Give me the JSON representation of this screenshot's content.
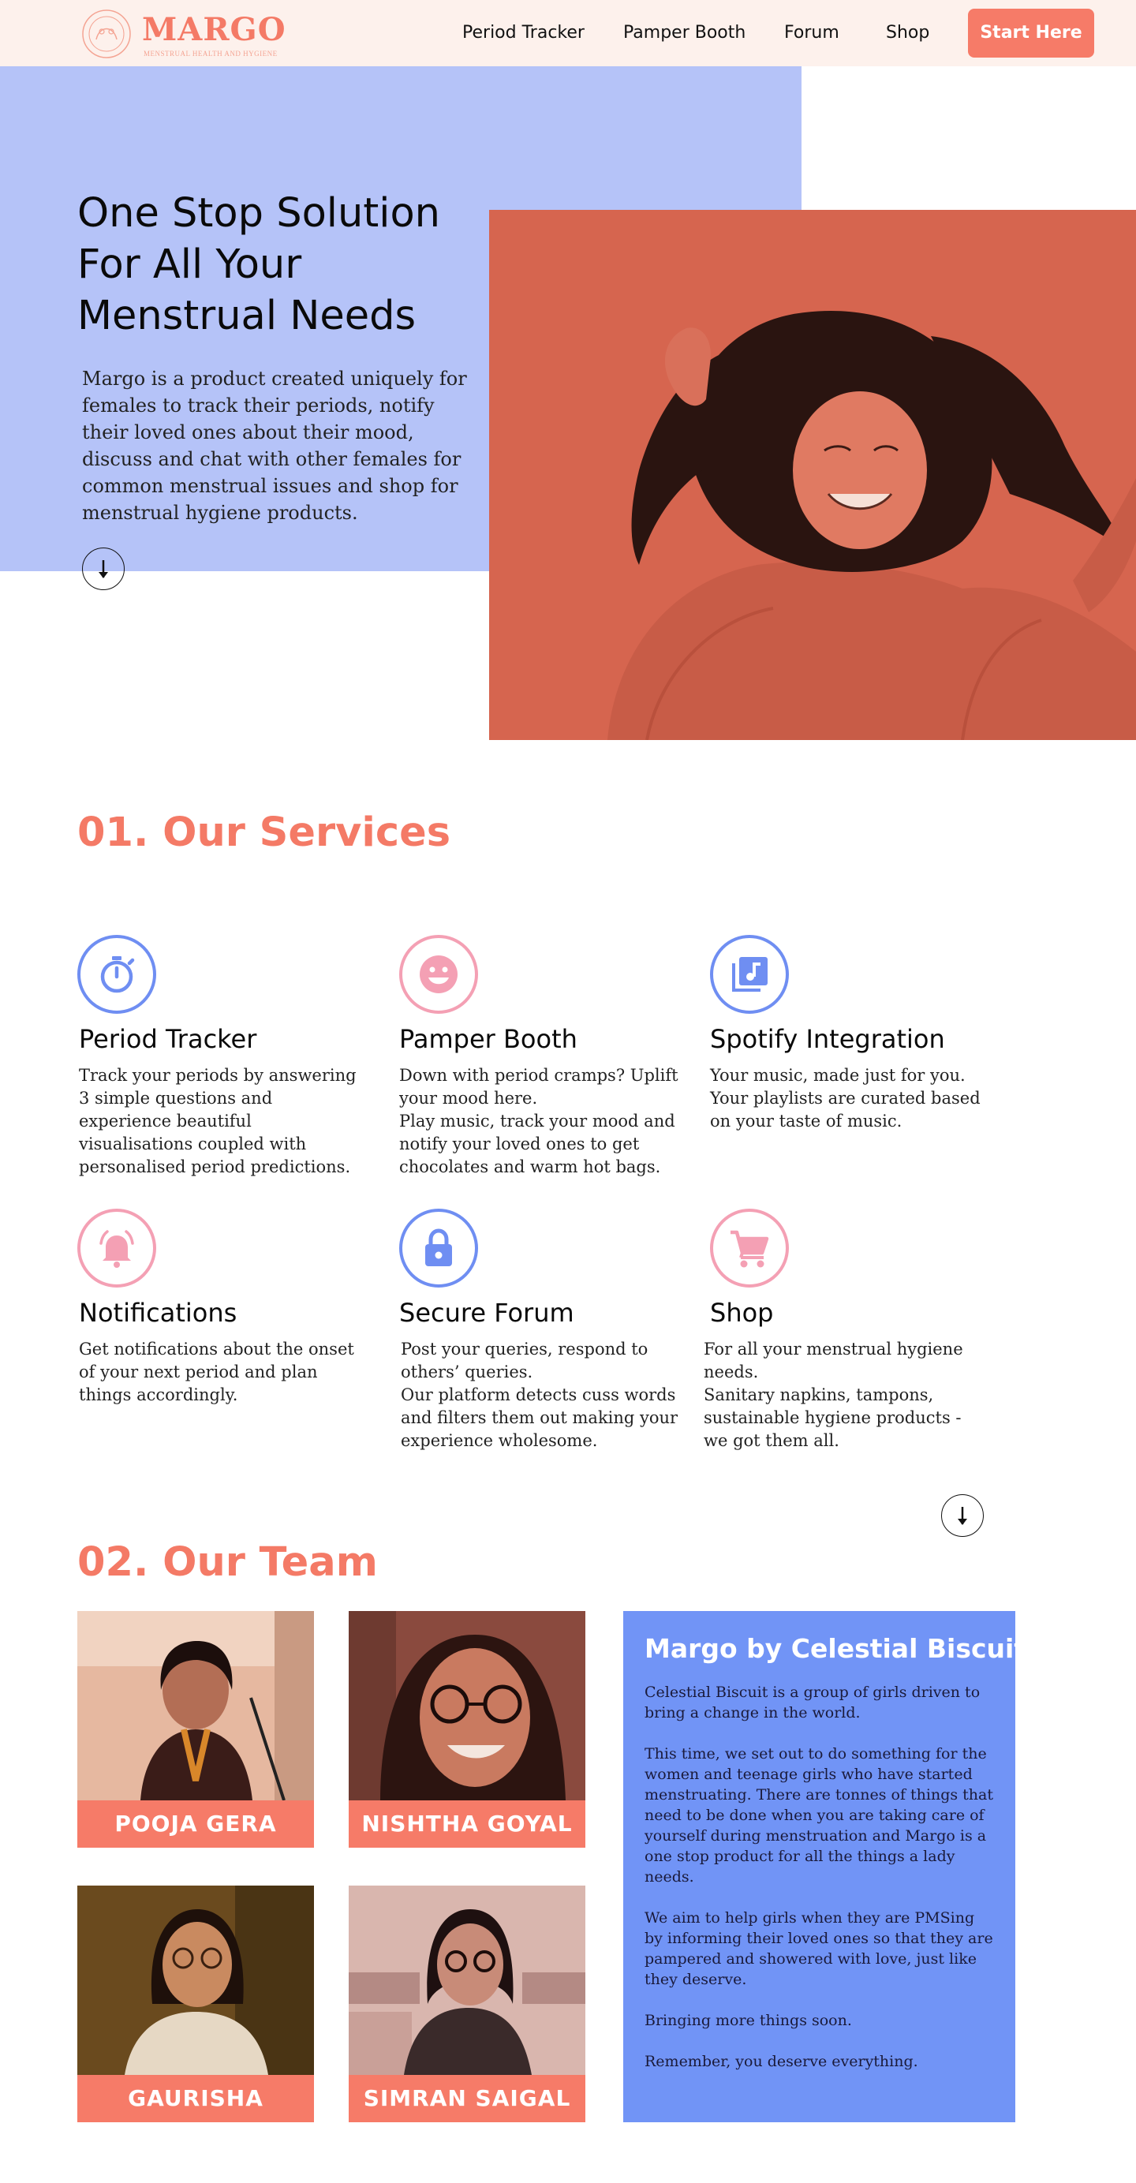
{
  "nav": {
    "logo_word": "MARGO",
    "logo_tagline": "MENSTRUAL HEALTH AND HYGIENE",
    "links": [
      "Period Tracker",
      "Pamper Booth",
      "Forum",
      "Shop"
    ],
    "cta_label": "Start Here"
  },
  "hero": {
    "title": "One Stop Solution For All Your Menstrual Needs",
    "description": "Margo is a product created uniquely for females to track their periods, notify their loved ones about their mood, discuss and chat with other females for common menstrual issues and shop for menstrual hygiene products.",
    "scroll_icon": "arrow-down-icon"
  },
  "services": {
    "heading": "01. Our Services",
    "items": [
      {
        "icon": "stopwatch-icon",
        "title": "Period Tracker",
        "description": "Track your periods by answering 3 simple questions and experience beautiful visualisations coupled with personalised period predictions."
      },
      {
        "icon": "smiley-icon",
        "title": "Pamper Booth",
        "description": "Down with period cramps? Uplift your mood here.\nPlay music, track your mood and notify your loved ones to get chocolates and warm hot bags."
      },
      {
        "icon": "music-library-icon",
        "title": "Spotify Integration",
        "description": "Your music, made just for you.\nYour playlists are curated based on your taste of music."
      },
      {
        "icon": "bell-icon",
        "title": "Notifications",
        "description": "Get notifications about the onset of your next period and plan things accordingly."
      },
      {
        "icon": "lock-icon",
        "title": "Secure Forum",
        "description": "Post your queries, respond to others’ queries.\nOur platform detects cuss words and filters them out making your experience wholesome."
      },
      {
        "icon": "cart-icon",
        "title": "Shop",
        "description": "For all your menstrual hygiene needs.\nSanitary napkins, tampons, sustainable hygiene products - we got them all."
      }
    ],
    "colors": {
      "blue": "#6f8ef2",
      "pink": "#f4a0b4"
    }
  },
  "team": {
    "heading": "02. Our Team",
    "members": [
      {
        "name": "POOJA GERA"
      },
      {
        "name": "NISHTHA GOYAL"
      },
      {
        "name": "GAURISHA"
      },
      {
        "name": "SIMRAN SAIGAL"
      }
    ],
    "about": {
      "title": "Margo by Celestial Biscuit",
      "body": "Celestial Biscuit is a group of girls driven to bring a change in the world.\n\nThis time, we set out to do something for the women and teenage girls who have started menstruating. There are tonnes of things that need to be done when you are taking care of yourself during menstruation and Margo is a  one stop product for all the things a lady needs.\n\nWe aim to help girls when they are PMSing by informing their loved ones so that they are pampered and showered with love, just like they deserve.\n\nBringing more things soon.\n\nRemember, you deserve everything."
    }
  },
  "colors": {
    "accent": "#f67b68",
    "hero_blue": "#b5c3f8",
    "about_blue": "#7194f6",
    "nav_bg": "#fdf1ec"
  }
}
